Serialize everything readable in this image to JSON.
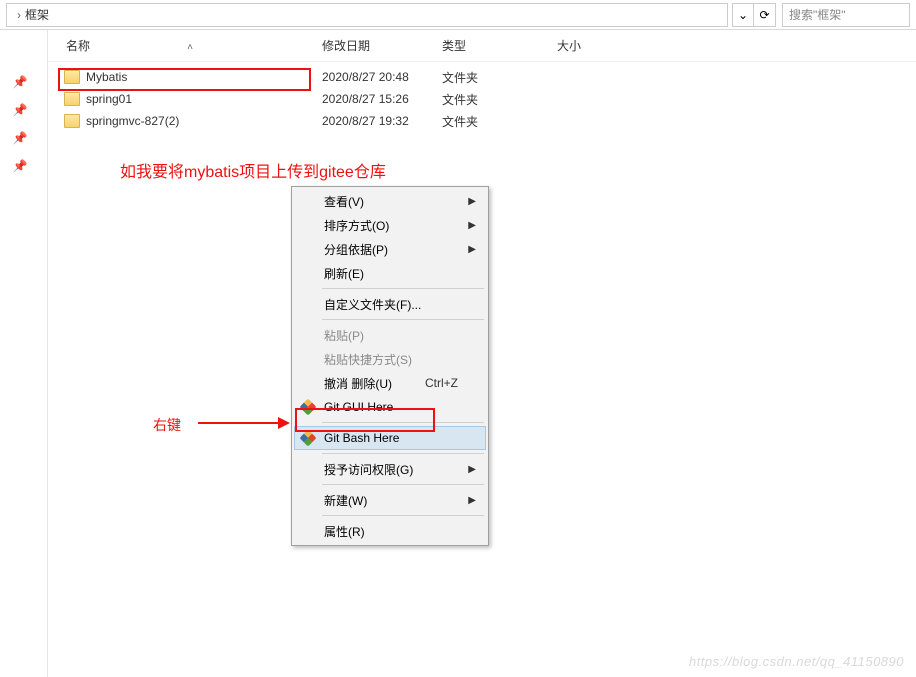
{
  "address": {
    "breadcrumb_sep": "›",
    "current_folder": "框架",
    "dropdown_glyph": "⌄",
    "refresh_glyph": "⟳",
    "search_placeholder": "搜索\"框架\""
  },
  "columns": {
    "name": "名称",
    "date": "修改日期",
    "type": "类型",
    "size": "大小",
    "sort_glyph": "˄"
  },
  "rows": [
    {
      "name": "Mybatis",
      "date": "2020/8/27 20:48",
      "type": "文件夹"
    },
    {
      "name": "spring01",
      "date": "2020/8/27 15:26",
      "type": "文件夹"
    },
    {
      "name": "springmvc-827(2)",
      "date": "2020/8/27 19:32",
      "type": "文件夹"
    }
  ],
  "annotations": {
    "line1": "如我要将mybatis项目上传到gitee仓库",
    "line2": "右键"
  },
  "context_menu": {
    "view": "查看(V)",
    "sort": "排序方式(O)",
    "group": "分组依据(P)",
    "refresh": "刷新(E)",
    "custom_folder": "自定义文件夹(F)...",
    "paste": "粘贴(P)",
    "paste_shortcut": "粘贴快捷方式(S)",
    "undo_delete": "撤消 删除(U)",
    "undo_key": "Ctrl+Z",
    "git_gui": "Git GUI Here",
    "git_bash": "Git Bash Here",
    "grant_access": "授予访问权限(G)",
    "new": "新建(W)",
    "properties": "属性(R)",
    "arrow": "▶"
  },
  "watermark": "https://blog.csdn.net/qq_41150890"
}
